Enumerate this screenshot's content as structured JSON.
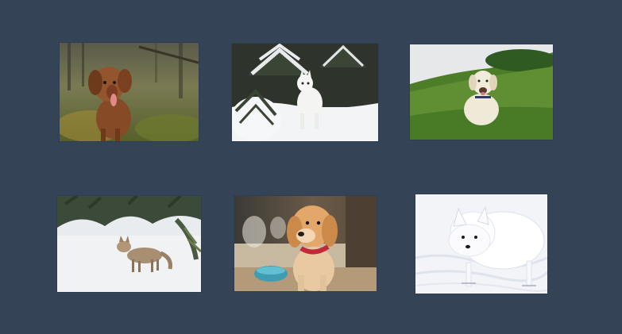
{
  "gallery": {
    "photos": [
      {
        "subject": "brown-retriever",
        "colors": {
          "bg": "#6b6a3a",
          "main": "#8a4e2a"
        }
      },
      {
        "subject": "white-dog-in-snowy-forest",
        "colors": {
          "bg": "#2c3328",
          "main": "#f2f3f4"
        }
      },
      {
        "subject": "labrador-on-grass",
        "colors": {
          "bg": "#4f7a2b",
          "main": "#eae3d2"
        }
      },
      {
        "subject": "coyote-in-snow",
        "colors": {
          "bg": "#f3f4f5",
          "main": "#a58d70"
        }
      },
      {
        "subject": "golden-puppy-with-red-collar",
        "colors": {
          "bg": "#b9ab95",
          "main": "#dda064"
        }
      },
      {
        "subject": "arctic-fox",
        "colors": {
          "bg": "#f4f5f8",
          "main": "#ffffff"
        }
      }
    ],
    "background_color": "#344456"
  }
}
